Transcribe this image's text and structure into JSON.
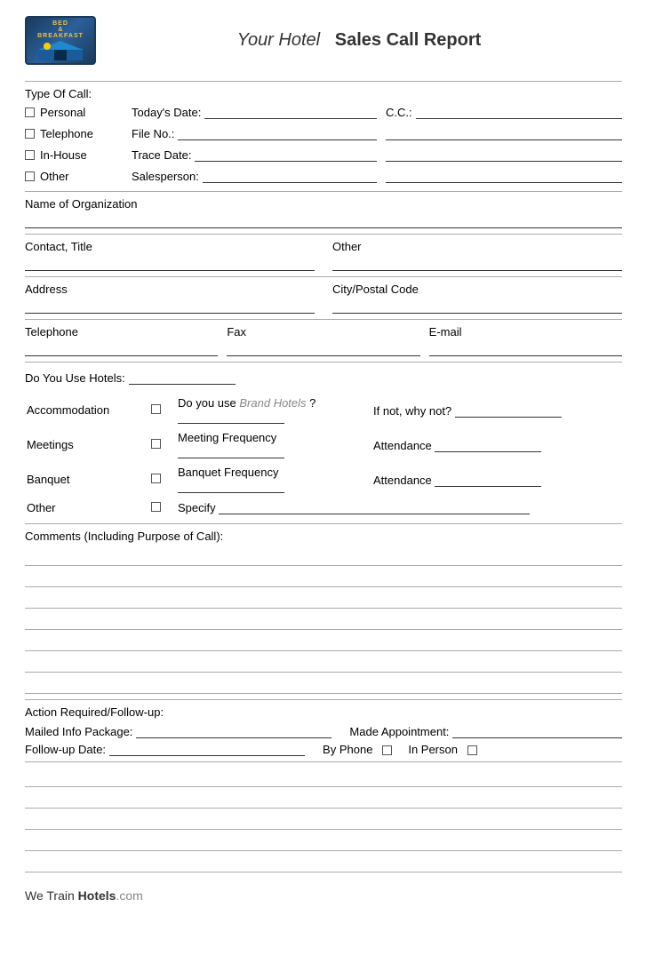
{
  "header": {
    "title_normal": "Your Hotel",
    "title_bold": "Sales Call Report",
    "logo_line1": "BED",
    "logo_line2": "&",
    "logo_line3": "BREAKFAST"
  },
  "type_of_call": {
    "label": "Type Of Call:",
    "options": [
      "Personal",
      "Telephone",
      "In-House",
      "Other"
    ]
  },
  "fields": {
    "todays_date_label": "Today's Date:",
    "cc_label": "C.C.:",
    "file_no_label": "File No.:",
    "trace_date_label": "Trace Date:",
    "salesperson_label": "Salesperson:",
    "name_of_org_label": "Name of Organization",
    "contact_title_label": "Contact, Title",
    "other_label": "Other",
    "address_label": "Address",
    "city_postal_code_label": "City/Postal Code",
    "telephone_label": "Telephone",
    "fax_label": "Fax",
    "email_label": "E-mail",
    "do_you_use_label": "Do You Use Hotels:",
    "accommodation_label": "Accommodation",
    "meetings_label": "Meetings",
    "banquet_label": "Banquet",
    "other2_label": "Other",
    "do_you_use_brand_label": "Do you use",
    "brand_name": "Brand Hotels",
    "question_mark": "?",
    "if_not_label": "If not, why not?",
    "meeting_freq_label": "Meeting Frequency",
    "attendance_label": "Attendance",
    "banquet_freq_label": "Banquet Frequency",
    "attendance2_label": "Attendance",
    "specify_label": "Specify",
    "comments_label": "Comments (Including Purpose of Call):",
    "action_label": "Action Required/Follow-up:",
    "mailed_info_label": "Mailed Info Package:",
    "made_appt_label": "Made Appointment:",
    "followup_date_label": "Follow-up Date:",
    "by_phone_label": "By Phone",
    "in_person_label": "In Person"
  },
  "footer": {
    "text_normal": "We Train Hotels",
    "text_com": ".com"
  }
}
